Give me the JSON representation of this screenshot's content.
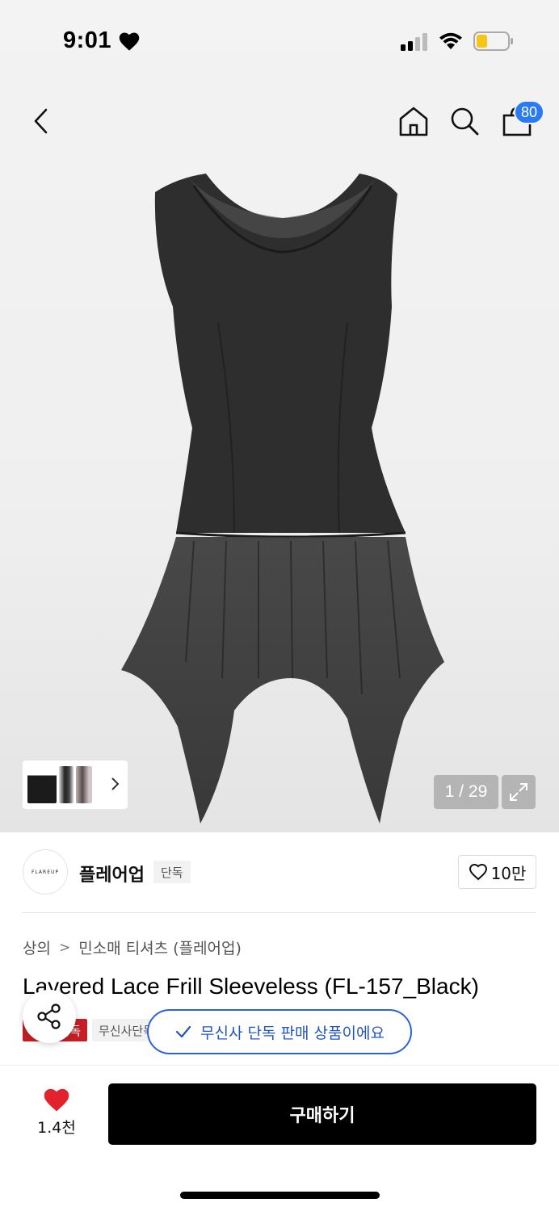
{
  "status_bar": {
    "time": "9:01"
  },
  "nav": {
    "cart_count": "80"
  },
  "gallery": {
    "counter": "1 / 29"
  },
  "brand": {
    "logo_text": "FLAREUP",
    "name": "플레어업",
    "tag": "단독",
    "likes": "10만"
  },
  "breadcrumb": {
    "category": "상의",
    "separator": ">",
    "subcategory": "민소매 티셔츠 (플레어업)"
  },
  "product": {
    "title": "Layered Lace Frill Sleeveless (FL-157_Black)",
    "tags": [
      "단독",
      "무신사단독"
    ]
  },
  "toast": {
    "text": "무신사 단독 판매 상품이에요"
  },
  "bottom": {
    "wish_count": "1.4천",
    "buy_label": "구매하기"
  },
  "colors": {
    "accent_blue": "#2a7bf3",
    "toast_blue": "#1f55c6",
    "red": "#e3232c"
  }
}
